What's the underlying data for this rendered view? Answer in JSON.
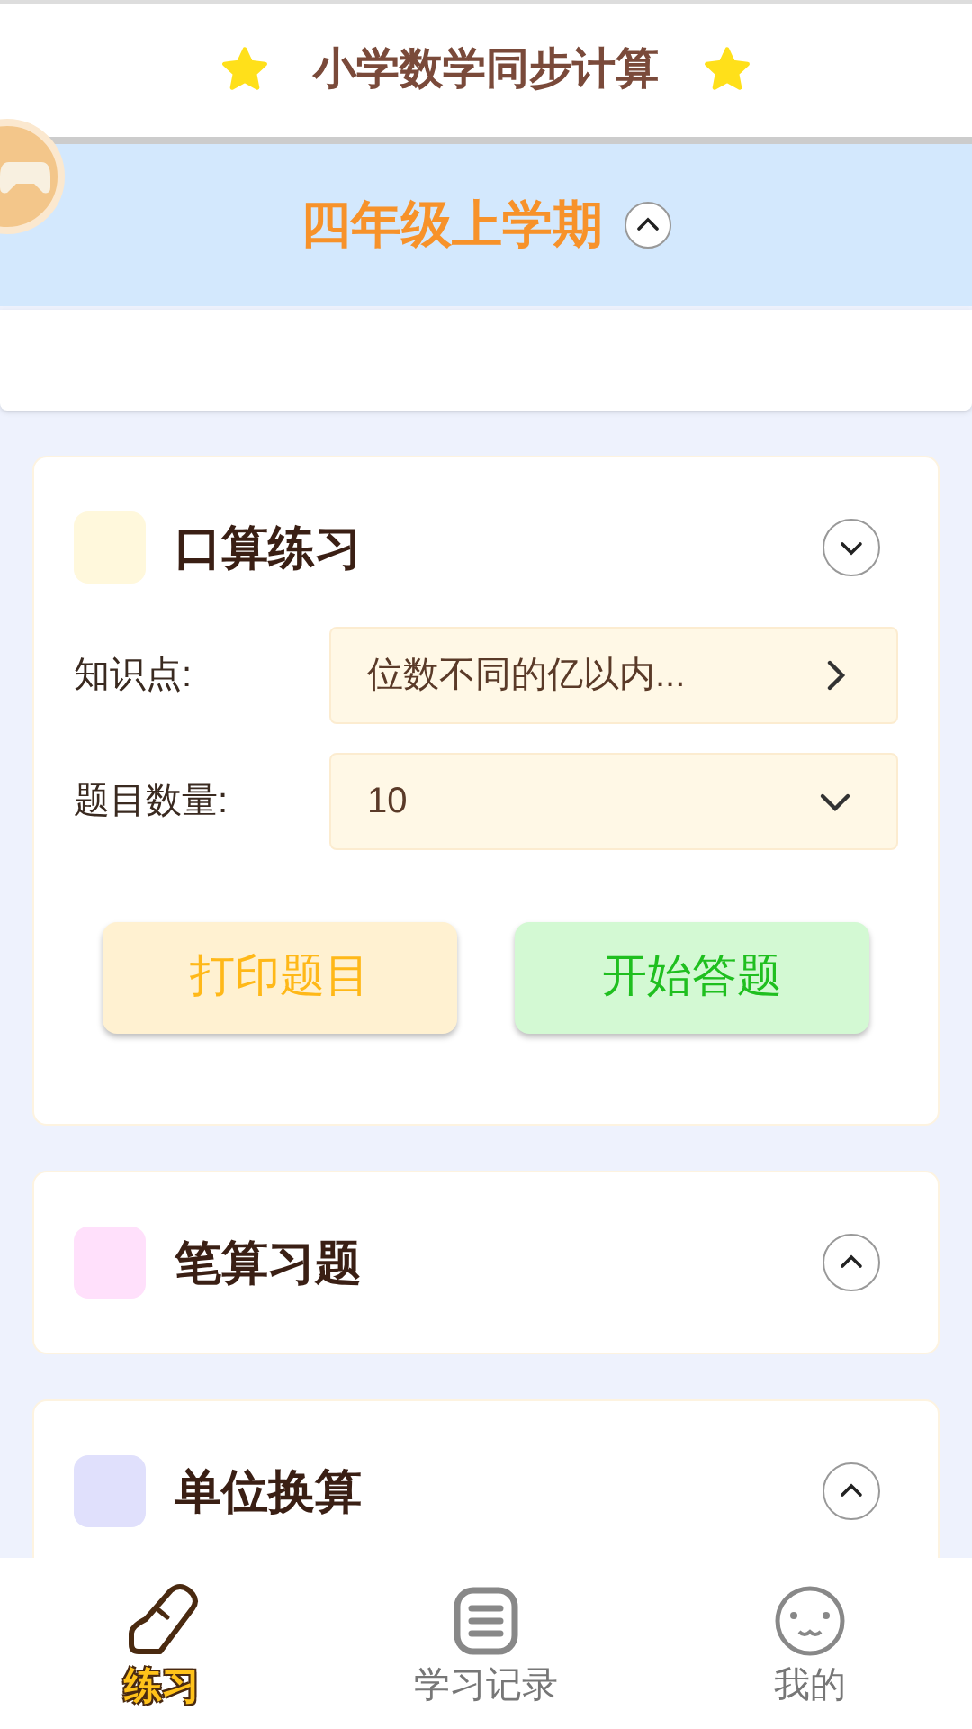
{
  "header": {
    "title": "小学数学同步计算"
  },
  "grade": {
    "title": "四年级上学期",
    "expanded": false
  },
  "sections": [
    {
      "title": "口算练习",
      "color": "#fff8dc",
      "expanded": true,
      "fields": [
        {
          "label": "知识点:",
          "value": "位数不同的亿以内...",
          "kind": "link"
        },
        {
          "label": "题目数量:",
          "value": "10",
          "kind": "select"
        }
      ],
      "buttons": [
        {
          "label": "打印题目",
          "kind": "print"
        },
        {
          "label": "开始答题",
          "kind": "start"
        }
      ]
    },
    {
      "title": "笔算习题",
      "color": "#ffe0fb",
      "expanded": false
    },
    {
      "title": "单位换算",
      "color": "#e0e0fc",
      "expanded": false
    }
  ],
  "tabs": [
    {
      "label": "练习",
      "kind": "practice",
      "selected": true
    },
    {
      "label": "学习记录",
      "kind": "records",
      "selected": false
    },
    {
      "label": "我的",
      "kind": "me",
      "selected": false
    }
  ]
}
